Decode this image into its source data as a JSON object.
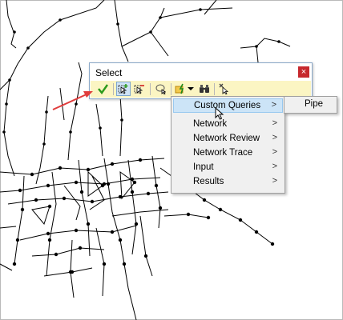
{
  "dialog": {
    "title": "Select",
    "close_glyph": "×",
    "toolbar": [
      {
        "name": "accept-checkmark-button",
        "icon": "checkmark-icon"
      },
      {
        "name": "add-to-selection-button",
        "icon": "select-add-icon"
      },
      {
        "name": "remove-from-selection-button",
        "icon": "select-remove-icon"
      },
      {
        "name": "select-by-shape-button",
        "icon": "lasso-icon"
      },
      {
        "name": "query-button",
        "icon": "query-lightning-icon"
      },
      {
        "name": "query-dropdown-button",
        "icon": "dropdown-arrow-icon"
      },
      {
        "name": "find-button",
        "icon": "binoculars-icon"
      },
      {
        "name": "clear-selection-button",
        "icon": "clear-selection-icon"
      }
    ]
  },
  "menu": {
    "chevron": ">",
    "items": [
      {
        "label": "Custom Queries",
        "highlighted": true
      },
      {
        "label": "Network"
      },
      {
        "label": "Network Review"
      },
      {
        "label": "Network Trace"
      },
      {
        "label": "Input"
      },
      {
        "label": "Results"
      }
    ]
  },
  "submenu": {
    "items": [
      {
        "label": "Pipe"
      }
    ]
  },
  "colors": {
    "toolbar_bg": "#fbf5c3",
    "menu_bg": "#f0f0f0",
    "highlight": "#cce4f7",
    "close_red": "#c6282d",
    "annotation_arrow": "#e03c3c",
    "network_lines": "#000000"
  }
}
